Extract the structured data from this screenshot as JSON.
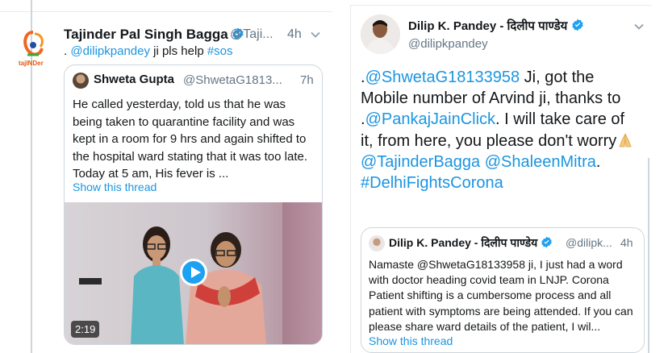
{
  "left_tweet": {
    "author_name": "Tajinder Pal Singh Bagga",
    "handle": "@Taji...",
    "time": "4h",
    "logo_text": "tajINDer",
    "body_prefix": ". ",
    "mention": "@dilipkpandey",
    "body_middle": " ji pls help ",
    "hashtag": "#sos",
    "quoted": {
      "author_name": "Shweta Gupta",
      "handle": "@ShwetaG1813...",
      "time": "7h",
      "text": "He called yesterday, told us that he was being taken to quarantine facility and was kept in a room for 9 hrs and again shifted to the hospital ward stating that it was too late. Today at 5 am, His fever is ...",
      "show_thread": "Show this thread",
      "video_duration": "2:19"
    }
  },
  "right_tweet": {
    "author_name": "Dilip K. Pandey - दिलीप पाण्डेय",
    "handle": "@dilipkpandey",
    "text_parts": {
      "p1": ".",
      "m1": "@ShwetaG18133958",
      "p2": " Ji, got the Mobile number of Arvind ji, thanks to .",
      "m2": "@PankajJainClick",
      "p3": ". I will take care of it, from here, you please don't worry",
      "m3": "@TajinderBagga",
      "p4": " ",
      "m4": "@ShaleenMitra",
      "p5": ".",
      "h1": "#DelhiFightsCorona"
    },
    "quoted": {
      "author_name": "Dilip K. Pandey - दिलीप पाण्डेय",
      "handle": "@dilipk...",
      "time": "4h",
      "text": "Namaste @ShwetaG18133958 ji, I just had a word with doctor heading covid team in LNJP. Corona Patient shifting is a cumbersome process and all patient with symptoms are being attended. If you can please share ward details of the patient, I wil...",
      "show_thread": "Show this thread"
    }
  },
  "colors": {
    "link": "#1b95e0",
    "verified": "#1da1f2",
    "muted": "#657786",
    "border": "#ccd6dd"
  }
}
